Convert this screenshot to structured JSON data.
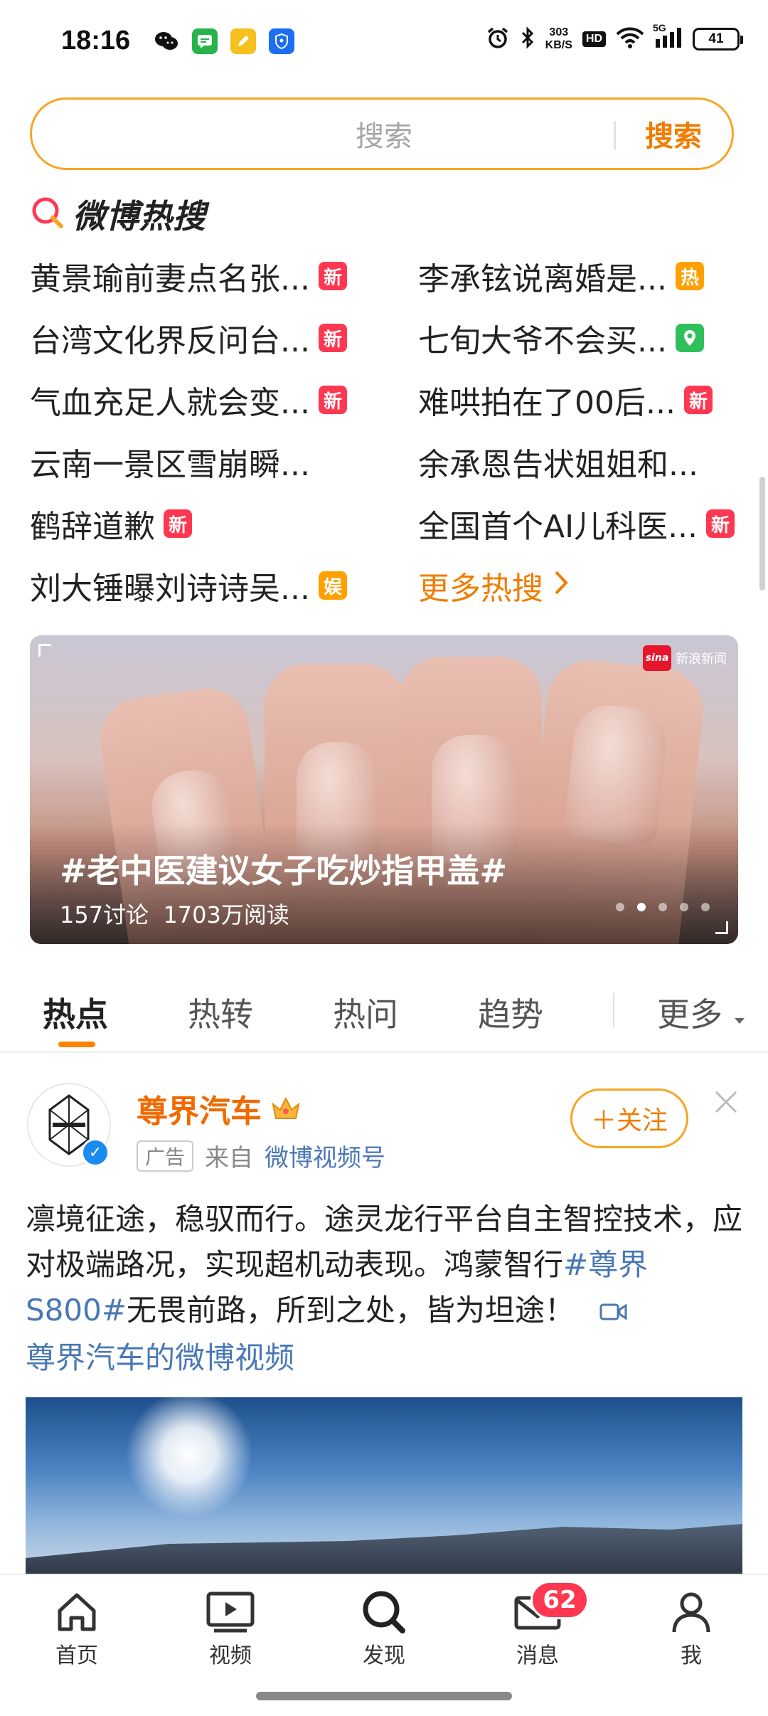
{
  "status_bar": {
    "time": "18:16",
    "net_speed_value": "303",
    "net_speed_unit": "KB/S",
    "hd_label": "HD",
    "signal_label": "5G",
    "battery_level": "41"
  },
  "search": {
    "placeholder": "搜索",
    "button_label": "搜索"
  },
  "hot_search": {
    "title": "微博热搜",
    "items": [
      {
        "text": "黄景瑜前妻点名张...",
        "badge": "新"
      },
      {
        "text": "李承铉说离婚是...",
        "badge": "热"
      },
      {
        "text": "台湾文化界反问台...",
        "badge": "新"
      },
      {
        "text": "七旬大爷不会买...",
        "badge": "location"
      },
      {
        "text": "气血充足人就会变...",
        "badge": "新"
      },
      {
        "text": "难哄拍在了00后...",
        "badge": "新"
      },
      {
        "text": "云南一景区雪崩瞬...",
        "badge": ""
      },
      {
        "text": "余承恩告状姐姐和...",
        "badge": ""
      },
      {
        "text": "鹤辞道歉",
        "badge": "新"
      },
      {
        "text": "全国首个AI儿科医...",
        "badge": "新"
      },
      {
        "text": "刘大锤曝刘诗诗吴...",
        "badge": "娱"
      }
    ],
    "more_label": "更多热搜"
  },
  "banner": {
    "title": "#老中医建议女子吃炒指甲盖#",
    "discussions": "157讨论",
    "reads": "1703万阅读",
    "source": "新浪新闻",
    "source_logo": "sina",
    "active_dot": 2,
    "dot_count": 5
  },
  "tabs": {
    "items": [
      "热点",
      "热转",
      "热问",
      "趋势"
    ],
    "active": "热点",
    "more_label": "更多"
  },
  "post": {
    "author": "尊界汽车",
    "ad_tag": "广告",
    "from_label": "来自",
    "from_source": "微博视频号",
    "follow_label": "＋关注",
    "text_part1": "凛境征途，稳驭而行。途灵龙行平台自主智控技术，应对极端路况，实现超机动表现。鸿蒙智行",
    "hashtag": "#尊界S800#",
    "text_part2": "无畏前路，所到之处，皆为坦途！",
    "video_link": "尊界汽车的微博视频"
  },
  "bottom_nav": {
    "items": [
      {
        "label": "首页",
        "icon": "home-icon"
      },
      {
        "label": "视频",
        "icon": "video-icon"
      },
      {
        "label": "发现",
        "icon": "search-icon"
      },
      {
        "label": "消息",
        "icon": "mail-icon"
      },
      {
        "label": "我",
        "icon": "profile-icon"
      }
    ],
    "message_badge": "62"
  },
  "colors": {
    "accent": "#f07d00",
    "search_border": "#f6a623",
    "badge_new": "#ff3852",
    "badge_hot": "#ffa000",
    "badge_location": "#2fbf5b",
    "link": "#4a78b6"
  }
}
